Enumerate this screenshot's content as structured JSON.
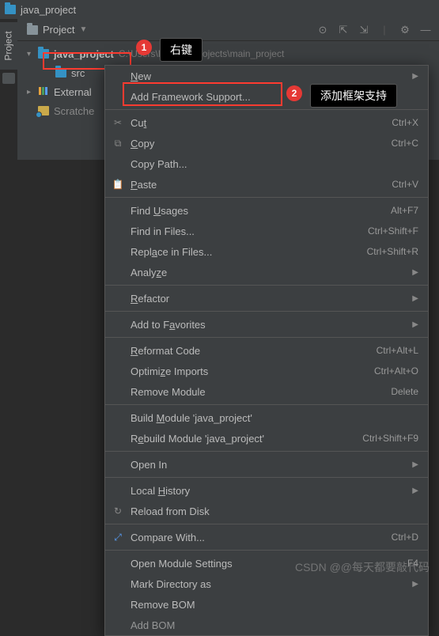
{
  "titlebar": {
    "title": "java_project"
  },
  "sidebar": {
    "label": "Project"
  },
  "toolbar": {
    "view_label": "Project"
  },
  "tree": {
    "project_name": "java_project",
    "project_path": "C:\\Users\\DH\\IdeaProjects\\main_project",
    "src": "src",
    "external": "External",
    "scratches": "Scratche"
  },
  "annotations": {
    "badge1": "1",
    "tooltip1": "右键",
    "badge2": "2",
    "tooltip2": "添加框架支持"
  },
  "menu": {
    "new": "New",
    "add_framework": "Add Framework Support...",
    "cut": {
      "label": "Cut",
      "key": "Ctrl+X"
    },
    "copy": {
      "label": "Copy",
      "key": "Ctrl+C"
    },
    "copy_path": "Copy Path...",
    "paste": {
      "label": "Paste",
      "key": "Ctrl+V"
    },
    "find_usages": {
      "label": "Find Usages",
      "key": "Alt+F7"
    },
    "find_in_files": {
      "label": "Find in Files...",
      "key": "Ctrl+Shift+F"
    },
    "replace_in_files": {
      "label": "Replace in Files...",
      "key": "Ctrl+Shift+R"
    },
    "analyze": "Analyze",
    "refactor": "Refactor",
    "add_favorites": "Add to Favorites",
    "reformat": {
      "label": "Reformat Code",
      "key": "Ctrl+Alt+L"
    },
    "optimize": {
      "label": "Optimize Imports",
      "key": "Ctrl+Alt+O"
    },
    "remove_module": {
      "label": "Remove Module",
      "key": "Delete"
    },
    "build": "Build Module 'java_project'",
    "rebuild": {
      "label": "Rebuild Module 'java_project'",
      "key": "Ctrl+Shift+F9"
    },
    "open_in": "Open In",
    "local_history": "Local History",
    "reload": "Reload from Disk",
    "compare": {
      "label": "Compare With...",
      "key": "Ctrl+D"
    },
    "open_module_settings": {
      "label": "Open Module Settings",
      "key": "F4"
    },
    "mark_directory": "Mark Directory as",
    "remove_bom": "Remove BOM",
    "add_bom": "Add BOM"
  },
  "watermark": "CSDN @@每天都要敲代码"
}
